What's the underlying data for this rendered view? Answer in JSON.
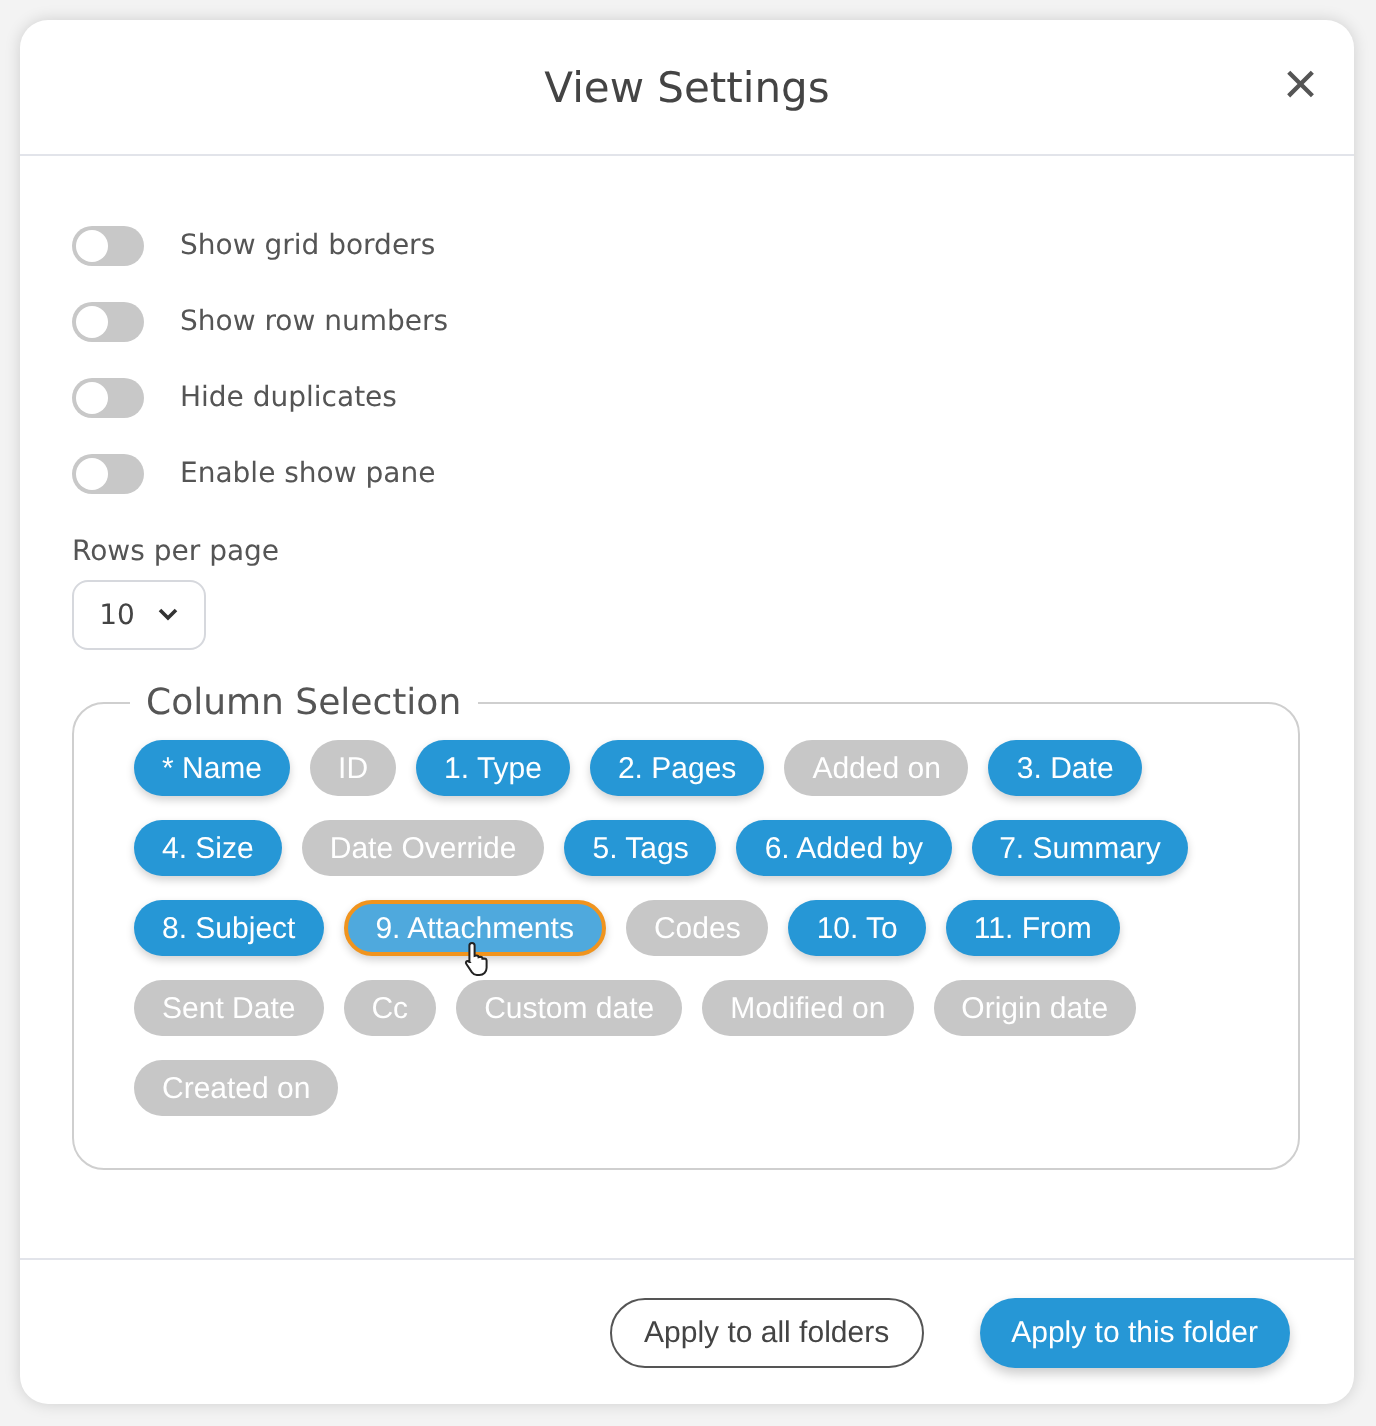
{
  "dialog": {
    "title": "View Settings",
    "close": "×"
  },
  "toggles": [
    {
      "label": "Show grid borders",
      "on": false
    },
    {
      "label": "Show row numbers",
      "on": false
    },
    {
      "label": "Hide duplicates",
      "on": false
    },
    {
      "label": "Enable show pane",
      "on": false
    }
  ],
  "rows_per_page": {
    "label": "Rows per page",
    "value": "10"
  },
  "column_selection": {
    "title": "Column Selection",
    "chips": [
      {
        "label": "* Name",
        "selected": true,
        "hovered": false
      },
      {
        "label": "ID",
        "selected": false,
        "hovered": false
      },
      {
        "label": "1. Type",
        "selected": true,
        "hovered": false
      },
      {
        "label": "2. Pages",
        "selected": true,
        "hovered": false
      },
      {
        "label": "Added on",
        "selected": false,
        "hovered": false
      },
      {
        "label": "3. Date",
        "selected": true,
        "hovered": false
      },
      {
        "label": "4. Size",
        "selected": true,
        "hovered": false
      },
      {
        "label": "Date Override",
        "selected": false,
        "hovered": false
      },
      {
        "label": "5. Tags",
        "selected": true,
        "hovered": false
      },
      {
        "label": "6. Added by",
        "selected": true,
        "hovered": false
      },
      {
        "label": "7. Summary",
        "selected": true,
        "hovered": false
      },
      {
        "label": "8. Subject",
        "selected": true,
        "hovered": false
      },
      {
        "label": "9. Attachments",
        "selected": true,
        "hovered": true
      },
      {
        "label": "Codes",
        "selected": false,
        "hovered": false
      },
      {
        "label": "10. To",
        "selected": true,
        "hovered": false
      },
      {
        "label": "11. From",
        "selected": true,
        "hovered": false
      },
      {
        "label": "Sent Date",
        "selected": false,
        "hovered": false
      },
      {
        "label": "Cc",
        "selected": false,
        "hovered": false
      },
      {
        "label": "Custom date",
        "selected": false,
        "hovered": false
      },
      {
        "label": "Modified on",
        "selected": false,
        "hovered": false
      },
      {
        "label": "Origin date",
        "selected": false,
        "hovered": false
      },
      {
        "label": "Created on",
        "selected": false,
        "hovered": false
      }
    ]
  },
  "buttons": [
    {
      "label": "Apply to all folders",
      "kind": "secondary"
    },
    {
      "label": "Apply to this folder",
      "kind": "primary"
    }
  ]
}
